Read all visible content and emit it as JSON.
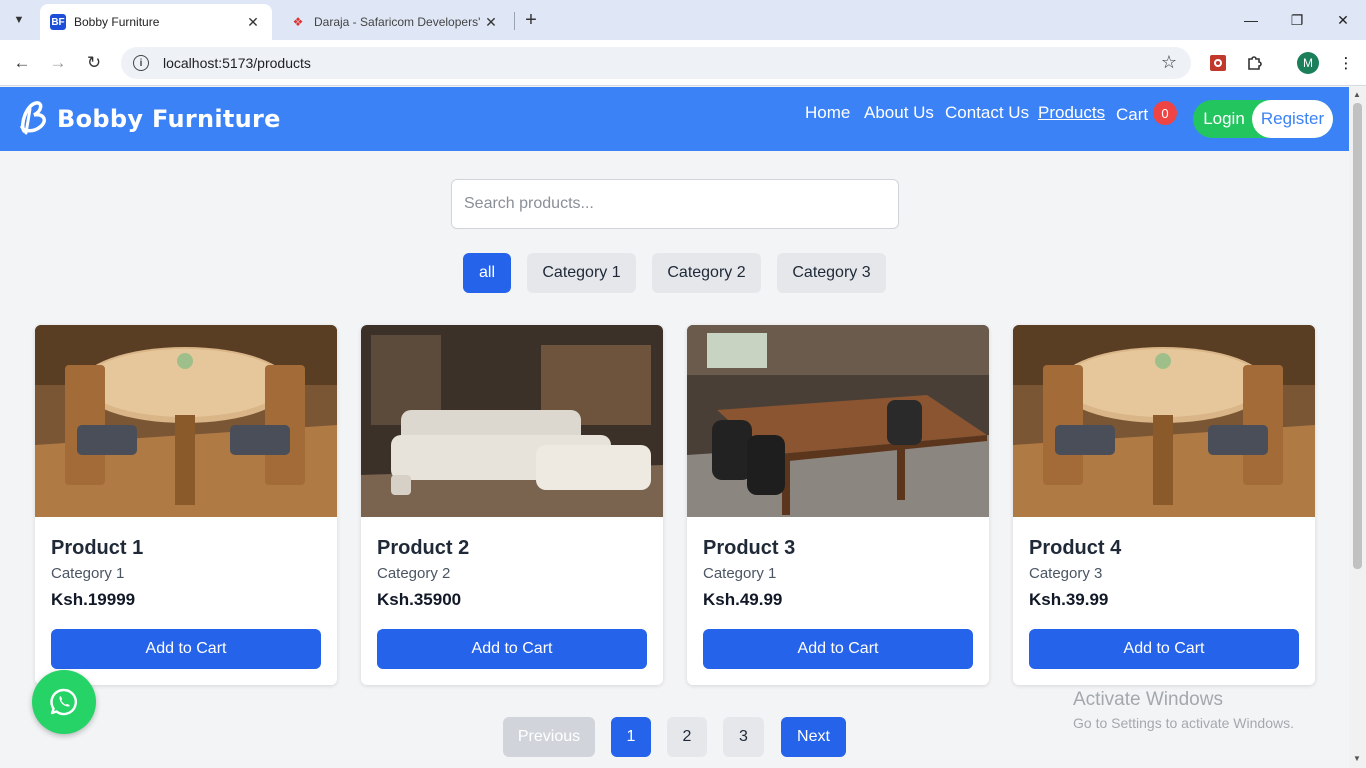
{
  "browser": {
    "tabs": [
      {
        "title": "Bobby Furniture",
        "favicon": "BF",
        "active": true
      },
      {
        "title": "Daraja - Safaricom Developers'",
        "favicon": "safaricom-logo",
        "active": false
      }
    ],
    "url": "localhost:5173/products",
    "profile_initial": "M"
  },
  "navbar": {
    "brand": "Bobby Furniture",
    "links": [
      "Home",
      "About Us",
      "Contact Us",
      "Products"
    ],
    "active_link": "Products",
    "cart_label": "Cart",
    "cart_count": "0",
    "login_label": "Login",
    "register_label": "Register",
    "colors": {
      "navbar": "#3b82f6",
      "login": "#22c55e",
      "badge": "#ef4444"
    }
  },
  "search": {
    "placeholder": "Search products..."
  },
  "filters": [
    "all",
    "Category 1",
    "Category 2",
    "Category 3"
  ],
  "active_filter": "all",
  "products": [
    {
      "name": "Product 1",
      "category": "Category 1",
      "price": "Ksh.19999",
      "button": "Add to Cart",
      "image": "round-dining-table-photo"
    },
    {
      "name": "Product 2",
      "category": "Category 2",
      "price": "Ksh.35900",
      "button": "Add to Cart",
      "image": "white-leather-sofa-photo"
    },
    {
      "name": "Product 3",
      "category": "Category 1",
      "price": "Ksh.49.99",
      "button": "Add to Cart",
      "image": "wooden-dining-table-photo"
    },
    {
      "name": "Product 4",
      "category": "Category 3",
      "price": "Ksh.39.99",
      "button": "Add to Cart",
      "image": "round-dining-table-photo"
    }
  ],
  "pagination": {
    "previous": "Previous",
    "pages": [
      "1",
      "2",
      "3"
    ],
    "current": "1",
    "next": "Next"
  },
  "whatsapp": {
    "icon": "whatsapp-icon"
  },
  "watermark": {
    "line1": "Activate Windows",
    "line2": "Go to Settings to activate Windows."
  },
  "accent_color": "#2563eb"
}
